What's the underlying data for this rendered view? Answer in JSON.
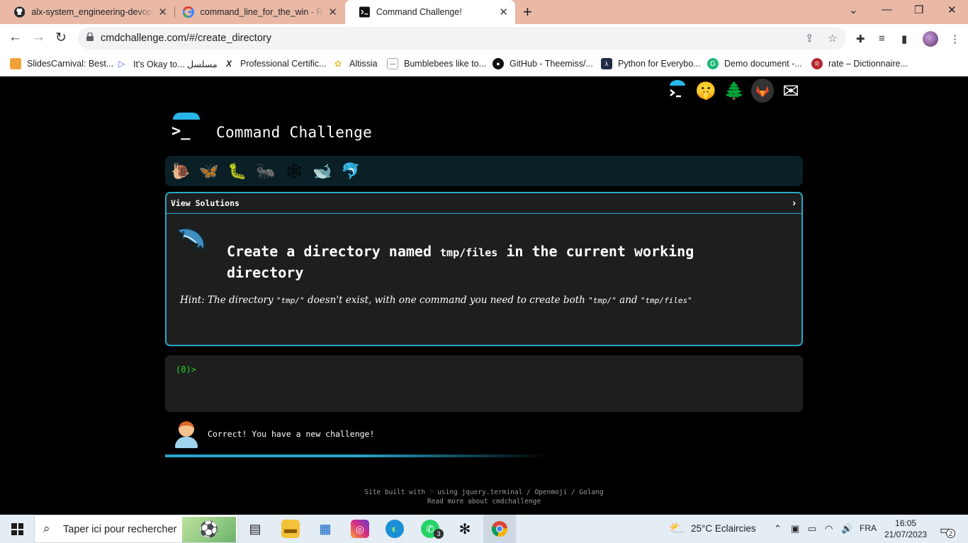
{
  "browser": {
    "tabs": [
      {
        "title": "alx-system_engineering-devops/c",
        "icon": "github-icon"
      },
      {
        "title": "command_line_for_the_win - Rec",
        "icon": "google-icon"
      },
      {
        "title": "Command Challenge!",
        "icon": "terminal-icon"
      }
    ],
    "new_tab": "+",
    "url": "cmdchallenge.com/#/create_directory",
    "bookmarks": [
      {
        "label": "SlidesCarnival: Best...",
        "color": "#f2a13a"
      },
      {
        "label": "It's Okay to... مسلسل",
        "color": "#3e6ff2"
      },
      {
        "label": "Professional Certific...",
        "color": "#111111"
      },
      {
        "label": "Altissia",
        "color": "#e8c13a"
      },
      {
        "label": "Bumblebees like to...",
        "color": "#777777"
      },
      {
        "label": "GitHub - Theemiss/...",
        "color": "#111111"
      },
      {
        "label": "Python for Everybo...",
        "color": "#1f2a44"
      },
      {
        "label": "Demo document -...",
        "color": "#1fb87a"
      },
      {
        "label": "rate – Dictionnaire...",
        "color": "#b5282d"
      }
    ]
  },
  "page": {
    "title": "Command Challenge",
    "logo_prompt": ">_",
    "top_icons": [
      "🤫",
      "🌲",
      "🦊",
      "✉"
    ],
    "levels": [
      "🐌",
      "🦋",
      "🐛",
      "🐜",
      "🕸",
      "🐋",
      "🐬"
    ],
    "challenge": {
      "view_solutions": "View Solutions",
      "chevron": "›",
      "task_before": "Create a directory named ",
      "task_code": "tmp/files",
      "task_after": " in the current working directory",
      "hint_1": "Hint: The directory ",
      "hint_code_1": "\"tmp/\"",
      "hint_2": " doesn't exist, with one command you need to create both ",
      "hint_code_2": "\"tmp/\"",
      "hint_3": " and ",
      "hint_code_3": "\"tmp/files\""
    },
    "terminal": {
      "prompt": "(0)>"
    },
    "status_message": "Correct! You have a new challenge!",
    "progress": 0.6,
    "footer_line1": "Site built with ♡ using jquery.terminal / Openmoji / Golang",
    "footer_line2": "Read more about cmdchallenge"
  },
  "taskbar": {
    "search_placeholder": "Taper ici pour rechercher",
    "weather": "25°C  Eclaircies",
    "language": "FRA",
    "time": "16:05",
    "date": "21/07/2023",
    "whatsapp_badge": "3",
    "notifications": "2"
  }
}
